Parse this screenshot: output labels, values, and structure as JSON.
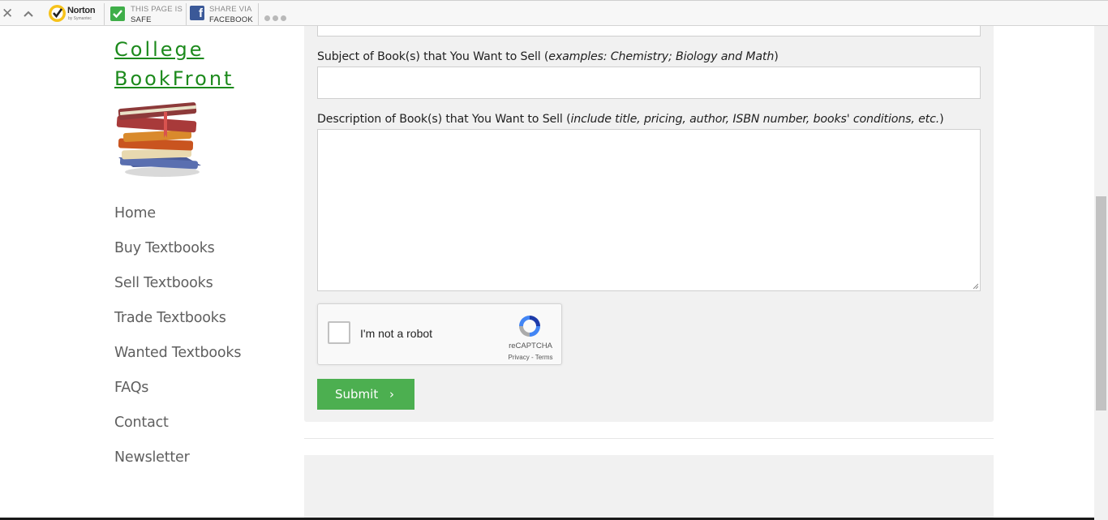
{
  "toolbar": {
    "close_glyph": "✕",
    "brand": "Norton",
    "brand_sub": "by Symantec",
    "safe_line1": "THIS PAGE IS",
    "safe_line2": "SAFE",
    "share_line1": "SHARE VIA",
    "share_line2": "FACEBOOK",
    "fb_glyph": "f"
  },
  "sidebar": {
    "title_line1": "College",
    "title_line2": "BookFront",
    "nav": [
      {
        "label": "Home"
      },
      {
        "label": "Buy Textbooks"
      },
      {
        "label": "Sell Textbooks"
      },
      {
        "label": "Trade Textbooks"
      },
      {
        "label": "Wanted Textbooks"
      },
      {
        "label": "FAQs"
      },
      {
        "label": "Contact"
      },
      {
        "label": "Newsletter"
      }
    ]
  },
  "form": {
    "subject_label": "Subject of Book(s) that You Want to Sell (",
    "subject_hint": "examples: Chemistry; Biology and Math",
    "subject_close": ")",
    "subject_value": "",
    "description_label": "Description of Book(s) that You Want to Sell (",
    "description_hint": "include title, pricing, author, ISBN number, books' conditions, etc.",
    "description_close": ")",
    "description_value": "",
    "captcha_text": "I'm not a robot",
    "captcha_brand": "reCAPTCHA",
    "captcha_links": "Privacy - Terms",
    "submit_label": "Submit",
    "submit_chevron": "›"
  },
  "colors": {
    "title_green": "#1c8a1c",
    "submit_green": "#4caf50",
    "panel_bg": "#f1f1f1"
  }
}
